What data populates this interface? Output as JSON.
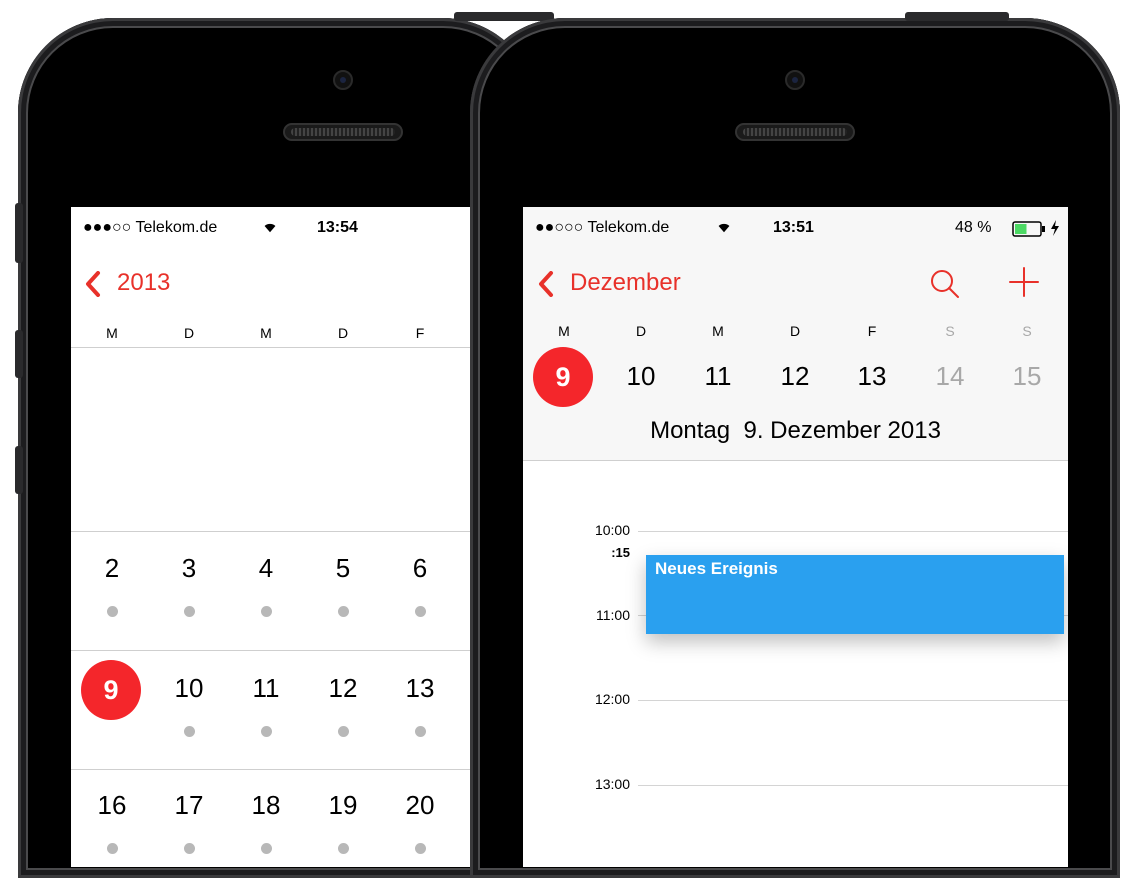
{
  "left_phone": {
    "status": {
      "carrier": "●●●○○ Telekom.de",
      "time": "13:54"
    },
    "nav": {
      "back_label": "2013"
    },
    "weekdays": [
      "M",
      "D",
      "M",
      "D",
      "F"
    ],
    "weeks": [
      {
        "days": [
          "2",
          "3",
          "4",
          "5",
          "6"
        ]
      },
      {
        "days": [
          "9",
          "10",
          "11",
          "12",
          "13"
        ],
        "today": "9"
      },
      {
        "days": [
          "16",
          "17",
          "18",
          "19",
          "20"
        ]
      }
    ]
  },
  "right_phone": {
    "status": {
      "carrier": "●●○○○ Telekom.de",
      "time": "13:51",
      "battery": "48 %",
      "battery_level": 0.48
    },
    "nav": {
      "back_label": "Dezember"
    },
    "weekdays": [
      "M",
      "D",
      "M",
      "D",
      "F",
      "S",
      "S"
    ],
    "week_days": [
      "9",
      "10",
      "11",
      "12",
      "13",
      "14",
      "15"
    ],
    "selected_day": "9",
    "date_title": "Montag  9. Dezember 2013",
    "times": [
      "10:00",
      ":15",
      "11:00",
      "12:00",
      "13:00"
    ],
    "event": {
      "title": "Neues Ereignis",
      "color": "#2aa0ef"
    }
  },
  "colors": {
    "accent": "#e8312a",
    "today": "#f4262b",
    "weekend": "#a8a8a8"
  },
  "icons": [
    "wifi-icon",
    "chevron-left-icon",
    "search-icon",
    "plus-icon",
    "battery-icon",
    "charging-bolt-icon"
  ]
}
